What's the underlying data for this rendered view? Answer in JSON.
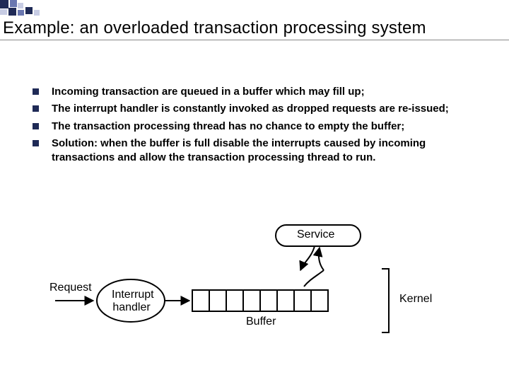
{
  "title": "Example: an overloaded transaction processing system",
  "bullets": [
    "Incoming transaction are queued in a buffer which may fill up;",
    "The interrupt handler is constantly invoked as dropped requests are re-issued;",
    "The transaction processing thread has no chance to empty the buffer;",
    "Solution: when the buffer is full disable the interrupts caused by incoming transactions and allow the transaction processing thread to run."
  ],
  "figure": {
    "request_label": "Request",
    "interrupt_handler_label_line1": "Interrupt",
    "interrupt_handler_label_line2": "handler",
    "buffer_label": "Buffer",
    "service_label": "Service",
    "kernel_label": "Kernel"
  },
  "deco_colors": {
    "dark": "#1f2a56",
    "mid": "#6a77b0",
    "light": "#c7cce4"
  }
}
